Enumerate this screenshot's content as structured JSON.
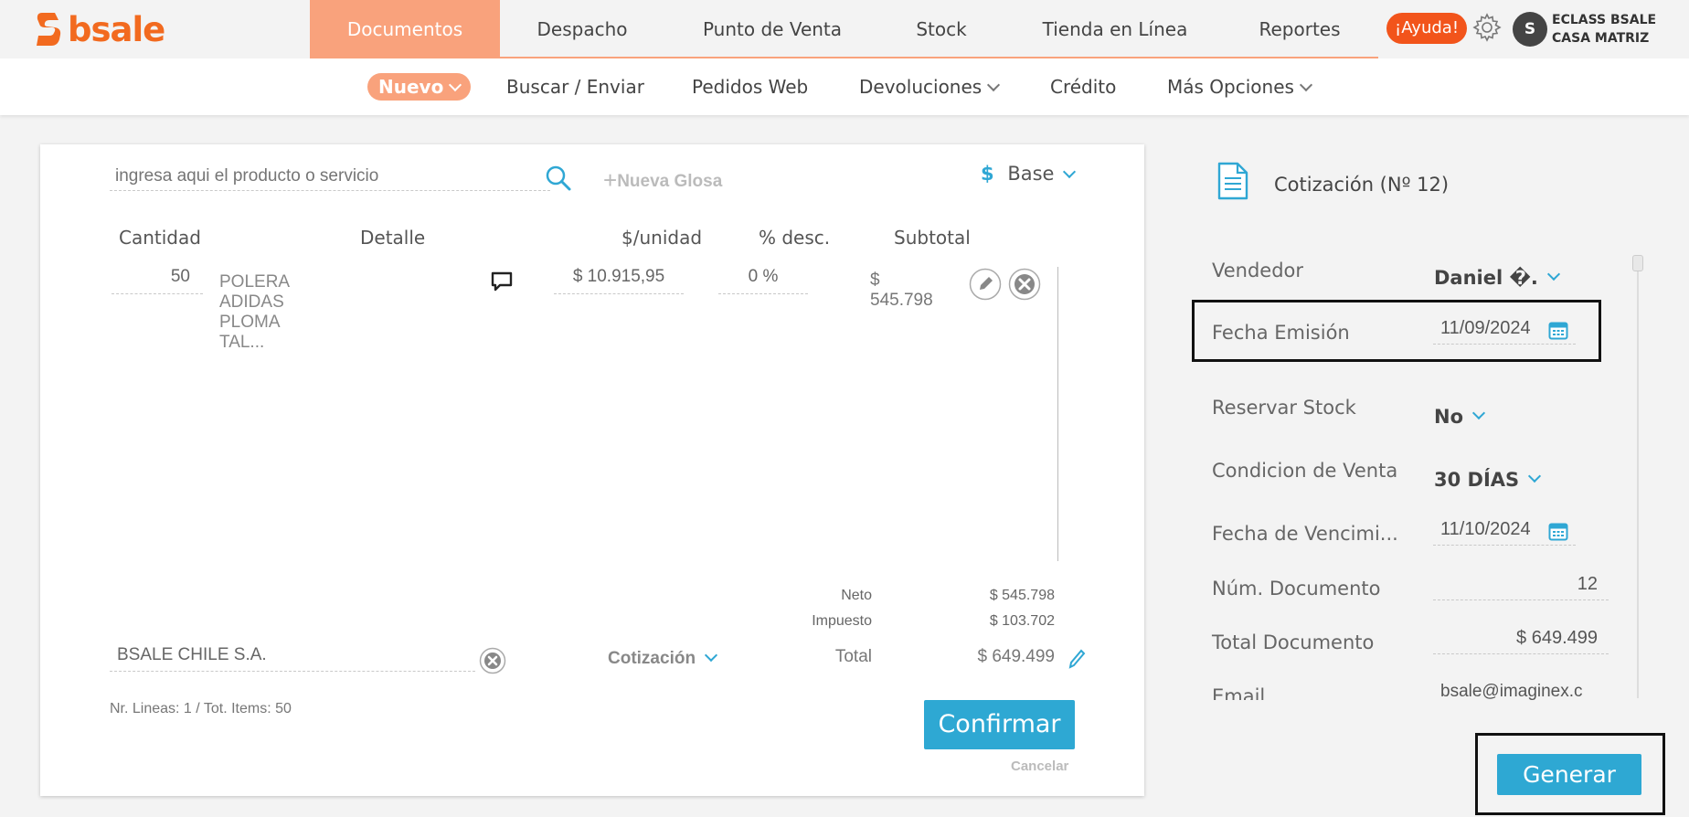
{
  "brand": {
    "name": "bsale",
    "color": "#f26a1f",
    "icon": "bsale-logo-icon"
  },
  "nav": {
    "tabs": [
      "Documentos",
      "Despacho",
      "Punto de Venta",
      "Stock",
      "Tienda en Línea",
      "Reportes"
    ],
    "active_tab": "Documentos",
    "help_label": "¡Ayuda!",
    "avatar_initial": "S",
    "company_line1": "ECLASS BSALE",
    "company_line2": "CASA MATRIZ",
    "accent": "#f9a27c"
  },
  "subnav": {
    "items": [
      "Nuevo",
      "Buscar / Enviar",
      "Pedidos Web",
      "Devoluciones",
      "Crédito",
      "Más Opciones"
    ],
    "active": "Nuevo"
  },
  "editor": {
    "search_placeholder": "ingresa aqui el producto o servicio",
    "new_gloss_label": "Nueva Glosa",
    "price_list_symbol": "$",
    "price_list": "Base",
    "columns": [
      "Cantidad",
      "Detalle",
      "$/unidad",
      "% desc.",
      "Subtotal"
    ],
    "rows": [
      {
        "qty": "50",
        "detail": "POLERA ADIDAS PLOMA TAL...",
        "unit_price": "$ 10.915,95",
        "discount": "0 %",
        "subtotal": "$ 545.798"
      }
    ],
    "totals": {
      "neto_label": "Neto",
      "neto": "$ 545.798",
      "tax_label": "Impuesto",
      "tax": "$ 103.702",
      "total_label": "Total",
      "total": "$ 649.499"
    },
    "client": "BSALE CHILE S.A.",
    "doc_type": "Cotización",
    "summary": "Nr. Lineas: 1 / Tot. Items: 50",
    "confirm_label": "Confirmar",
    "cancel_label": "Cancelar"
  },
  "panel": {
    "doc_title": "Cotización (Nº 12)",
    "fields": {
      "vendedor_label": "Vendedor",
      "vendedor": "Daniel �.",
      "fecha_emision_label": "Fecha Emisión",
      "fecha_emision": "11/09/2024",
      "reservar_label": "Reservar Stock",
      "reservar": "No",
      "condicion_label": "Condicion de Venta",
      "condicion": "30 DÍAS",
      "vencimiento_label": "Fecha de Vencimi...",
      "vencimiento": "11/10/2024",
      "num_doc_label": "Núm. Documento",
      "num_doc": "12",
      "total_doc_label": "Total Documento",
      "total_doc": "$ 649.499",
      "email_label": "Email",
      "email": "bsale@imaginex.c"
    },
    "generate_label": "Generar"
  },
  "colors": {
    "primary_button": "#2ea8d3",
    "orange_badge": "#f2541b"
  }
}
